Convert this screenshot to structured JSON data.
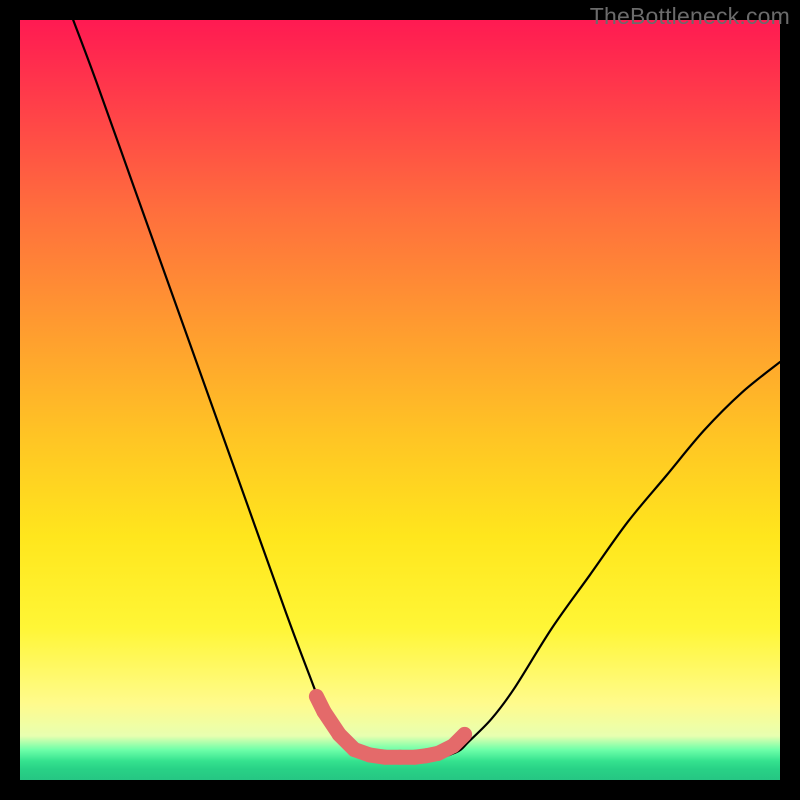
{
  "watermark": "TheBottleneck.com",
  "chart_data": {
    "type": "line",
    "title": "",
    "xlabel": "",
    "ylabel": "",
    "xlim": [
      0,
      100
    ],
    "ylim": [
      0,
      100
    ],
    "series": [
      {
        "name": "curve-left",
        "x": [
          7,
          10,
          15,
          20,
          25,
          30,
          35,
          38,
          40,
          42,
          44,
          47,
          49
        ],
        "values": [
          100,
          92,
          78,
          64,
          50,
          36,
          22,
          14,
          9,
          6,
          4,
          3,
          3
        ]
      },
      {
        "name": "curve-right",
        "x": [
          49,
          55,
          57,
          58,
          59,
          62,
          65,
          70,
          75,
          80,
          85,
          90,
          95,
          100
        ],
        "values": [
          3,
          3,
          3.5,
          4,
          5,
          8,
          12,
          20,
          27,
          34,
          40,
          46,
          51,
          55
        ]
      },
      {
        "name": "highlight-dots",
        "x": [
          39,
          40,
          42,
          44,
          46,
          48,
          50,
          52,
          53.5,
          55,
          57,
          58.5
        ],
        "values": [
          11,
          9,
          6,
          4,
          3.3,
          3,
          3,
          3,
          3.2,
          3.5,
          4.5,
          6
        ]
      }
    ],
    "colors": {
      "curve": "#000000",
      "highlight": "#e46a6a",
      "gradient_top": "#ff1a52",
      "gradient_bottom": "#26c683"
    }
  }
}
